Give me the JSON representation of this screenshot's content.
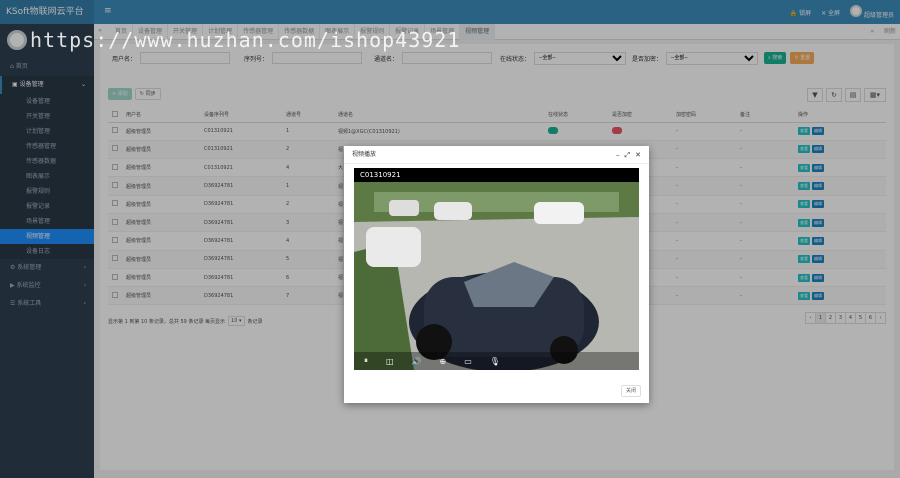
{
  "app": {
    "brand": "KSoft物联网云平台",
    "menu_icon": "≡"
  },
  "topbar": {
    "lock": "锁屏",
    "fullscreen": "全屏",
    "user": "超级管理员"
  },
  "tabs": [
    "首页",
    "设备管理",
    "开关管理",
    "计划管理",
    "传感器管理",
    "传感器数据",
    "图表展示",
    "报警规则",
    "报警记录",
    "场景管理",
    "视频管理"
  ],
  "tabs_right": {
    "close": "»",
    "refresh": "刷新"
  },
  "sidebar": {
    "home": "首页",
    "device_mgmt": "设备管理",
    "sub": [
      "设备管理",
      "开关管理",
      "计划管理",
      "传感器管理",
      "传感器数据",
      "图表展示",
      "报警规则",
      "报警记录",
      "场景管理",
      "视频管理",
      "设备日志"
    ],
    "system_mgmt": "系统管理",
    "system_monitor": "系统监控",
    "system_tools": "系统工具"
  },
  "search": {
    "user": "用户名：",
    "serial": "序列号：",
    "channel_name": "通道名：",
    "online": "在线状态：",
    "online_val": "--全部--",
    "encrypted": "是否加密：",
    "encrypted_val": "--全部--",
    "search_btn": "搜索",
    "reset_btn": "重置"
  },
  "toolbar": {
    "add": "添加",
    "sync": "同步"
  },
  "table": {
    "headers": [
      "用户名",
      "设备序列号",
      "通道号",
      "通道名",
      "在线状态",
      "是否加密",
      "加密密码",
      "备注",
      "操作"
    ],
    "rows": [
      [
        "超级管理员",
        "C01310921",
        "1",
        "视频1@XGC(C01310921)",
        "green",
        "red",
        "-",
        "-"
      ],
      [
        "超级管理员",
        "C01310921",
        "2",
        "视",
        "",
        "",
        "-",
        "-"
      ],
      [
        "超级管理员",
        "C01310921",
        "4",
        "大",
        "",
        "",
        "-",
        "-"
      ],
      [
        "超级管理员",
        "D36924781",
        "1",
        "视",
        "",
        "",
        "-",
        "-"
      ],
      [
        "超级管理员",
        "D36924781",
        "2",
        "视",
        "",
        "",
        "-",
        "-"
      ],
      [
        "超级管理员",
        "D36924781",
        "3",
        "视",
        "",
        "",
        "-",
        "-"
      ],
      [
        "超级管理员",
        "D36924781",
        "4",
        "视",
        "",
        "",
        "-",
        "-"
      ],
      [
        "超级管理员",
        "D36924781",
        "5",
        "视",
        "",
        "",
        "-",
        "-"
      ],
      [
        "超级管理员",
        "D36924781",
        "6",
        "视",
        "",
        "",
        "-",
        "-"
      ],
      [
        "超级管理员",
        "D36924781",
        "7",
        "视",
        "",
        "",
        "-",
        "-"
      ]
    ],
    "op_view": "查看",
    "op_edit": "编辑"
  },
  "pager": {
    "info": "显示第 1 到第 10 条记录，总共 59 条记录 每页显示",
    "size": "10 ▾",
    "suffix": "条记录",
    "pages": [
      "‹",
      "1",
      "2",
      "3",
      "4",
      "5",
      "6",
      "›"
    ]
  },
  "modal": {
    "title": "视频播放",
    "channel": "C01310921",
    "close_btn": "关闭"
  },
  "watermark": "https://www.huzhan.com/ishop43921"
}
